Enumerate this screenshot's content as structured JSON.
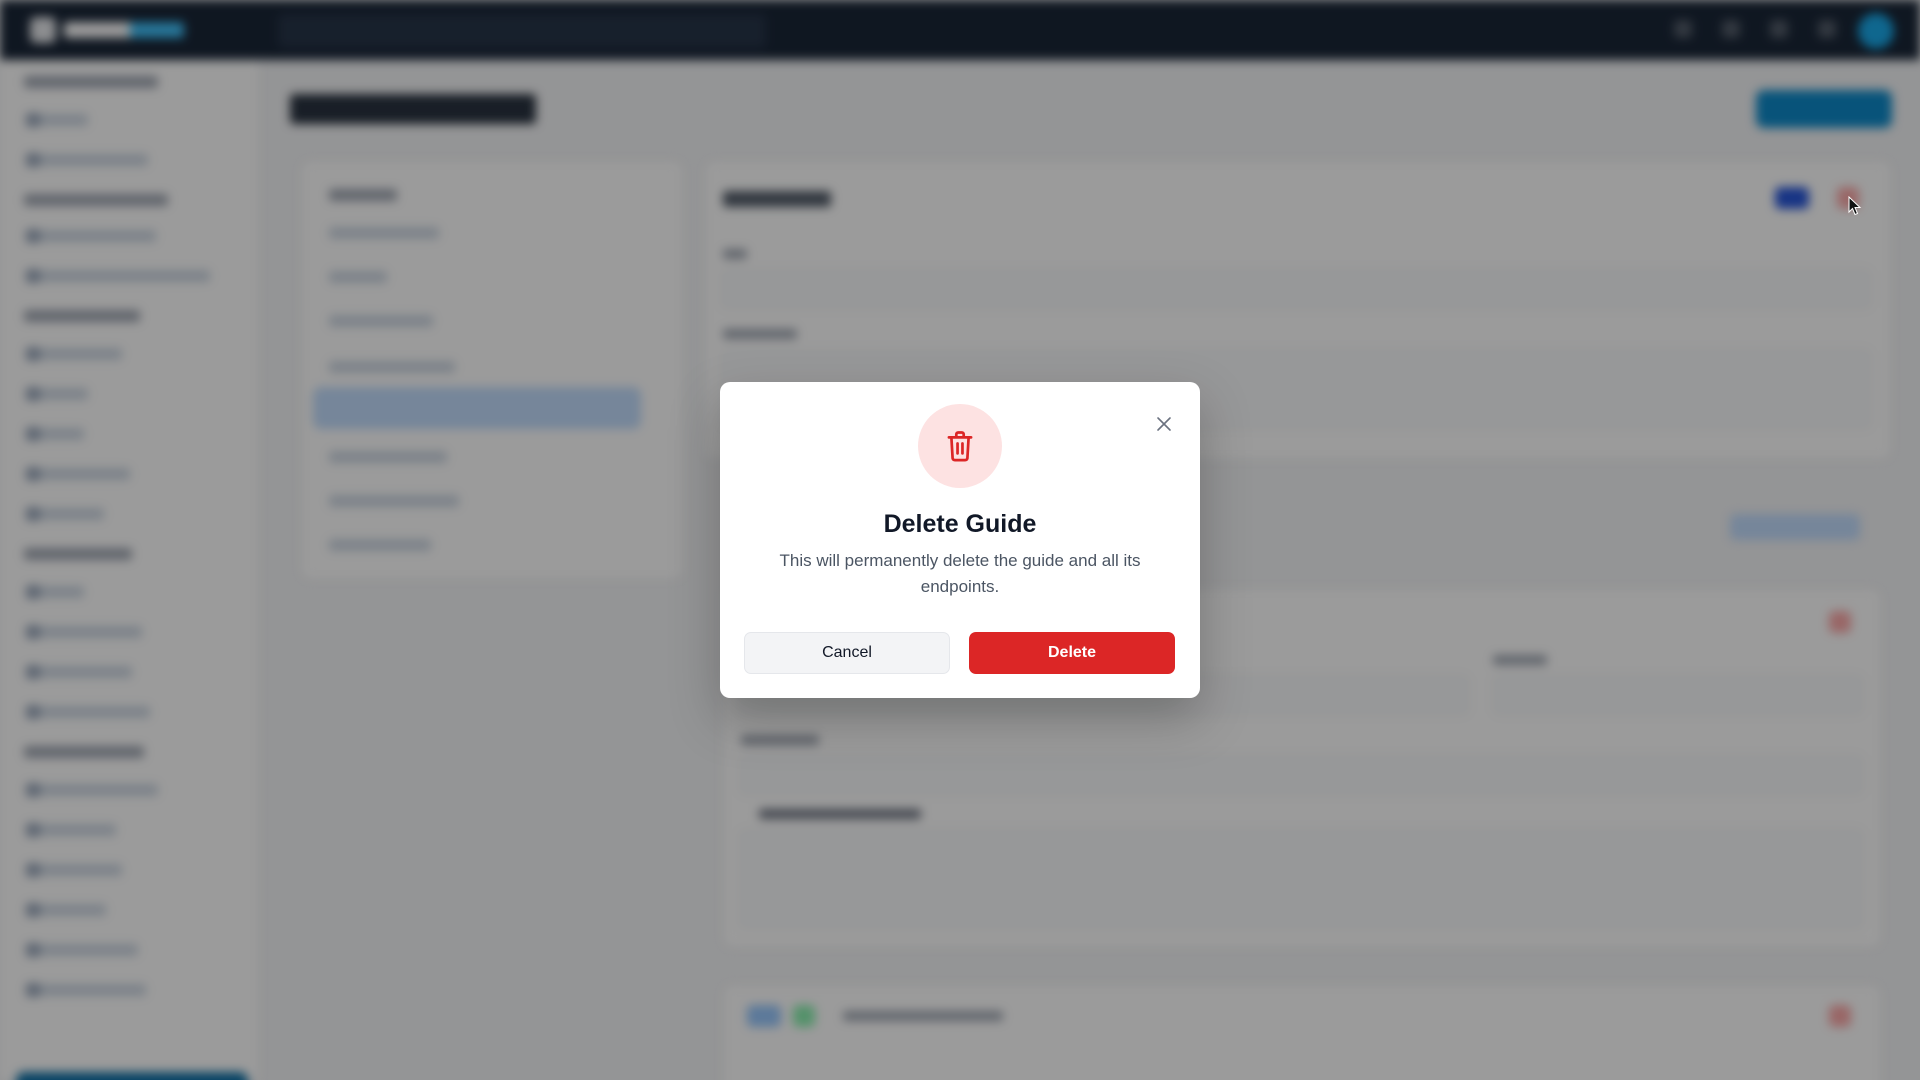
{
  "dialog": {
    "title": "Delete Guide",
    "message": "This will permanently delete the guide and all its endpoints.",
    "cancel_label": "Cancel",
    "delete_label": "Delete",
    "icon": "trash-icon",
    "close_icon": "close-icon"
  },
  "colors": {
    "danger": "#dc2626",
    "danger_soft": "#fde2e2",
    "overlay": "rgba(17,17,17,0.42)",
    "topbar": "#0f1c2e",
    "accent": "#0284c7"
  }
}
